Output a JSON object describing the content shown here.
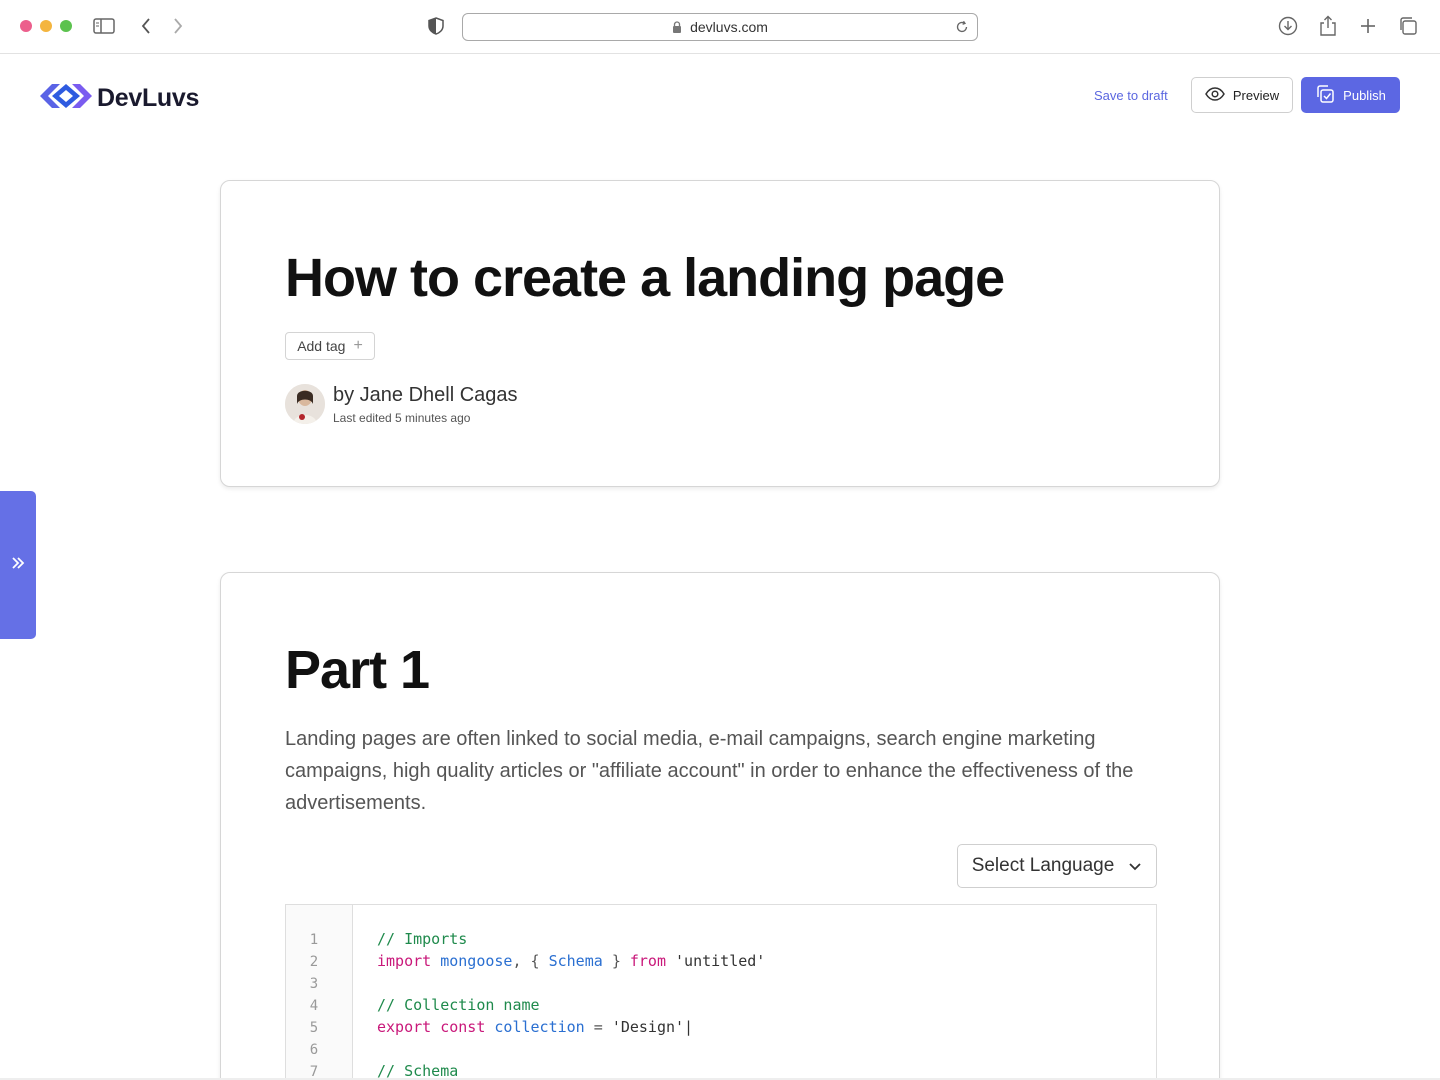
{
  "browser": {
    "url": "devluvs.com"
  },
  "header": {
    "logo_text": "DevLuvs",
    "save_draft_label": "Save to draft",
    "preview_label": "Preview",
    "publish_label": "Publish"
  },
  "post": {
    "title": "How to create a landing page",
    "add_tag_label": "Add tag",
    "author": "by Jane Dhell Cagas",
    "last_edited": "Last edited 5 minutes ago"
  },
  "section": {
    "heading": "Part 1",
    "body": "Landing pages are often linked to social media, e-mail campaigns, search engine marketing campaigns, high quality articles or \"affiliate account\" in order to enhance the effectiveness of the advertisements.",
    "select_language_label": "Select Language"
  },
  "code": {
    "line_numbers": [
      "1",
      "2",
      "3",
      "4",
      "5",
      "6",
      "7"
    ],
    "line1": "// Imports",
    "line2_kw1": "import",
    "line2_id1": "mongoose",
    "line2_p1": ", {",
    "line2_id2": "Schema",
    "line2_p2": "}",
    "line2_kw2": "from",
    "line2_str": "'untitled'",
    "line4": "// Collection name",
    "line5_kw1": "export",
    "line5_kw2": "const",
    "line5_id": "collection",
    "line5_p": "=",
    "line5_str": "'Design'|",
    "line7": "// Schema"
  },
  "colors": {
    "brand": "#5c67e3",
    "comment": "#1f8a4c",
    "keyword": "#c9187a",
    "identifier": "#2a6fd1"
  }
}
